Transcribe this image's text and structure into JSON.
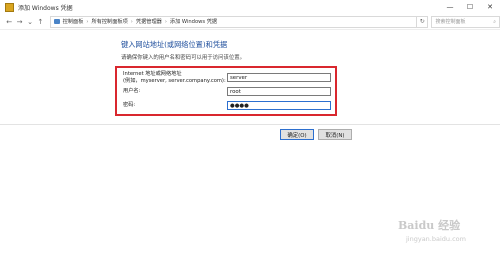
{
  "window": {
    "title": "添加 Windows 凭据",
    "minimize": "—",
    "maximize": "☐",
    "close": "✕"
  },
  "nav": {
    "back": "←",
    "forward": "→",
    "dropdown": "⌄",
    "up": "↑",
    "breadcrumb": [
      "控制面板",
      "所有控制面板项",
      "凭据管理器",
      "添加 Windows 凭据"
    ],
    "separator": "›",
    "refresh": "↻",
    "search_placeholder": "搜索控制面板",
    "search_icon": "⌕"
  },
  "main": {
    "heading": "键入网站地址(或网络位置)和凭据",
    "subtext": "请确保你键入的用户名和密码可以用于访问该位置。",
    "fields": [
      {
        "label_line1": "Internet 地址或网络地址",
        "label_line2": "(例如，myserver, server.company.com):",
        "value": "server"
      },
      {
        "label_line1": "用户名:",
        "label_line2": "",
        "value": "root"
      },
      {
        "label_line1": "密码:",
        "label_line2": "",
        "value": "●●●●"
      }
    ],
    "ok_label": "确定(O)",
    "cancel_label": "取消(N)"
  },
  "watermark": {
    "text": "Baidu 经验",
    "sub": "jingyan.baidu.com"
  }
}
